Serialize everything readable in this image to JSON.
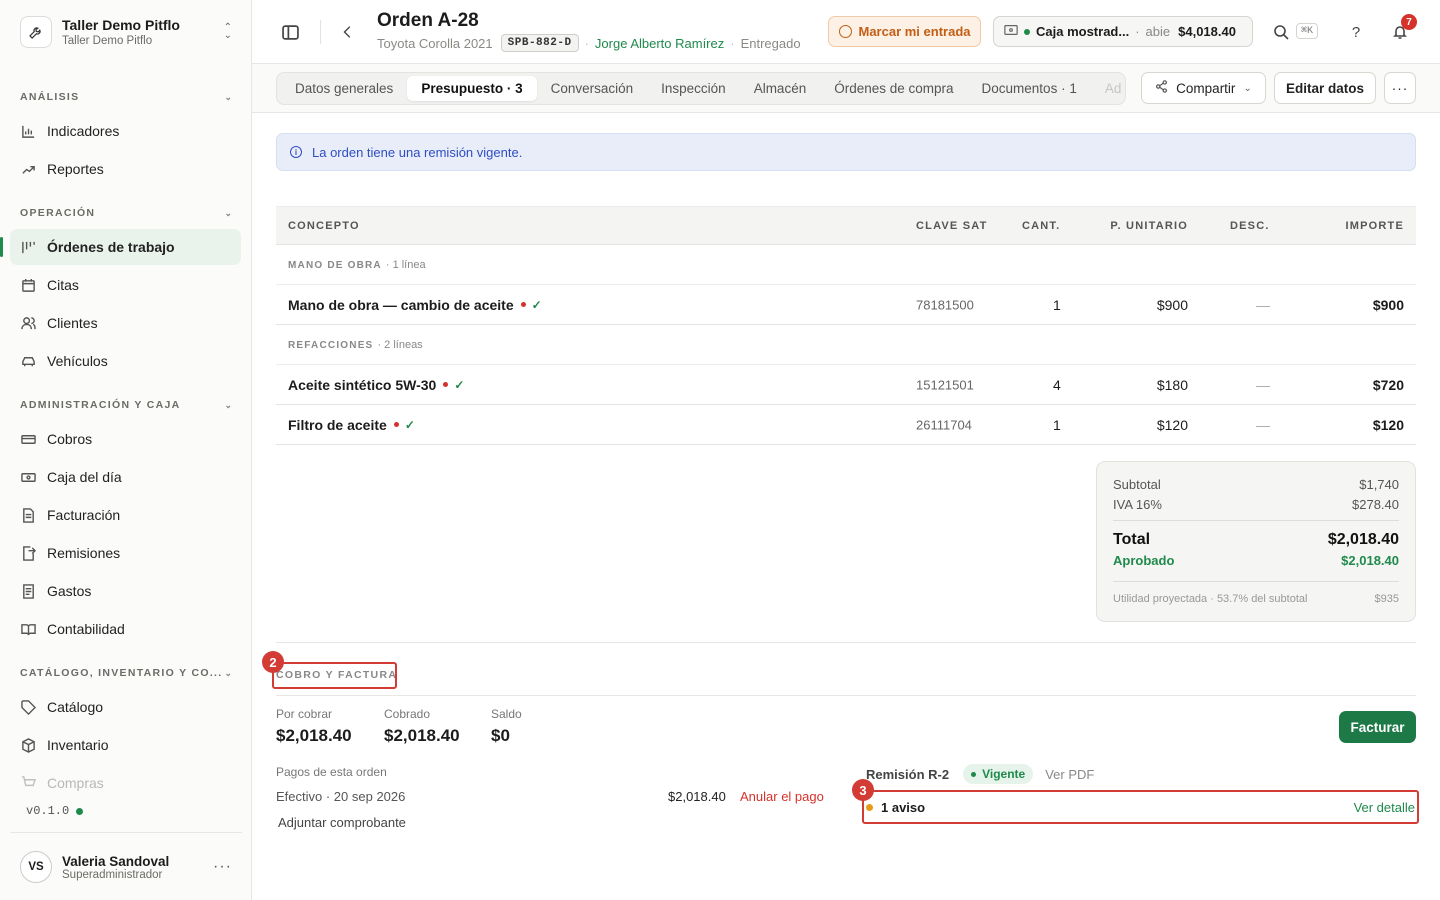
{
  "workspace": {
    "name": "Taller Demo Pitflo",
    "sub": "Taller Demo Pitflo"
  },
  "sidebar": {
    "sections": [
      {
        "label": "ANÁLISIS",
        "items": [
          {
            "label": "Indicadores",
            "icon": "bar-chart-icon"
          },
          {
            "label": "Reportes",
            "icon": "trend-icon"
          }
        ]
      },
      {
        "label": "OPERACIÓN",
        "items": [
          {
            "label": "Órdenes de trabajo",
            "icon": "kanban-icon",
            "active": true
          },
          {
            "label": "Citas",
            "icon": "calendar-icon"
          },
          {
            "label": "Clientes",
            "icon": "users-icon"
          },
          {
            "label": "Vehículos",
            "icon": "car-icon"
          }
        ]
      },
      {
        "label": "ADMINISTRACIÓN Y CAJA",
        "items": [
          {
            "label": "Cobros",
            "icon": "cash-icon"
          },
          {
            "label": "Caja del día",
            "icon": "register-icon"
          },
          {
            "label": "Facturación",
            "icon": "invoice-icon"
          },
          {
            "label": "Remisiones",
            "icon": "file-arrow-icon"
          },
          {
            "label": "Gastos",
            "icon": "receipt-icon"
          },
          {
            "label": "Contabilidad",
            "icon": "book-icon"
          }
        ]
      },
      {
        "label": "CATÁLOGO, INVENTARIO Y CO...",
        "items": [
          {
            "label": "Catálogo",
            "icon": "tag-icon"
          },
          {
            "label": "Inventario",
            "icon": "box-icon"
          },
          {
            "label": "Compras",
            "icon": "cart-icon"
          }
        ]
      }
    ],
    "version": "v0.1.0",
    "user": {
      "initials": "VS",
      "name": "Valeria Sandoval",
      "role": "Superadministrador"
    }
  },
  "header": {
    "title": "Orden A-28",
    "vehicle": "Toyota Corolla 2021",
    "plate": "SPB-882-D",
    "client": "Jorge Alberto Ramírez",
    "status": "Entregado",
    "clock_in": "Marcar mi entrada",
    "register": {
      "name": "Caja mostrad...",
      "state": "abie",
      "amount": "$4,018.40"
    },
    "shortcut": "⌘K",
    "notifications": "7"
  },
  "tabs": [
    "Datos generales",
    "Presupuesto · 3",
    "Conversación",
    "Inspección",
    "Almacén",
    "Órdenes de compra",
    "Documentos · 1",
    "Ad"
  ],
  "actions": {
    "share": "Compartir",
    "edit": "Editar datos"
  },
  "alert": "La orden tiene una remisión vigente.",
  "table": {
    "headers": [
      "CONCEPTO",
      "CLAVE SAT",
      "CANT.",
      "P. UNITARIO",
      "DESC.",
      "IMPORTE"
    ],
    "groups": [
      {
        "label": "MANO DE OBRA",
        "count": "· 1 línea",
        "rows": [
          {
            "name": "Mano de obra — cambio de aceite",
            "sat": "78181500",
            "qty": "1",
            "unit": "$900",
            "disc": "—",
            "amount": "$900"
          }
        ]
      },
      {
        "label": "REFACCIONES",
        "count": "· 2 líneas",
        "rows": [
          {
            "name": "Aceite sintético 5W-30",
            "sat": "15121501",
            "qty": "4",
            "unit": "$180",
            "disc": "—",
            "amount": "$720"
          },
          {
            "name": "Filtro de aceite",
            "sat": "26111704",
            "qty": "1",
            "unit": "$120",
            "disc": "—",
            "amount": "$120"
          }
        ]
      }
    ]
  },
  "totals": {
    "subtotal_label": "Subtotal",
    "subtotal": "$1,740",
    "iva_label": "IVA 16%",
    "iva": "$278.40",
    "total_label": "Total",
    "total": "$2,018.40",
    "approved_label": "Aprobado",
    "approved": "$2,018.40",
    "profit_label": "Utilidad proyectada · 53.7% del subtotal",
    "profit": "$935"
  },
  "billing": {
    "section": "COBRO Y FACTURA",
    "por_cobrar_label": "Por cobrar",
    "por_cobrar": "$2,018.40",
    "cobrado_label": "Cobrado",
    "cobrado": "$2,018.40",
    "saldo_label": "Saldo",
    "saldo": "$0",
    "facturar": "Facturar",
    "payments_label": "Pagos de esta orden",
    "payment": {
      "desc": "Efectivo · 20 sep 2026",
      "amount": "$2,018.40",
      "void": "Anular el pago"
    },
    "attach": "Adjuntar comprobante",
    "remision": {
      "title": "Remisión R-2",
      "status": "Vigente",
      "pdf": "Ver PDF"
    },
    "notice": {
      "text": "1 aviso",
      "link": "Ver detalle"
    }
  },
  "markers": [
    "2",
    "3"
  ],
  "colors": {
    "accent": "#1f8a4c",
    "warning": "#c25e16",
    "highlight": "#d33b35",
    "info": "#2f4ec2"
  }
}
